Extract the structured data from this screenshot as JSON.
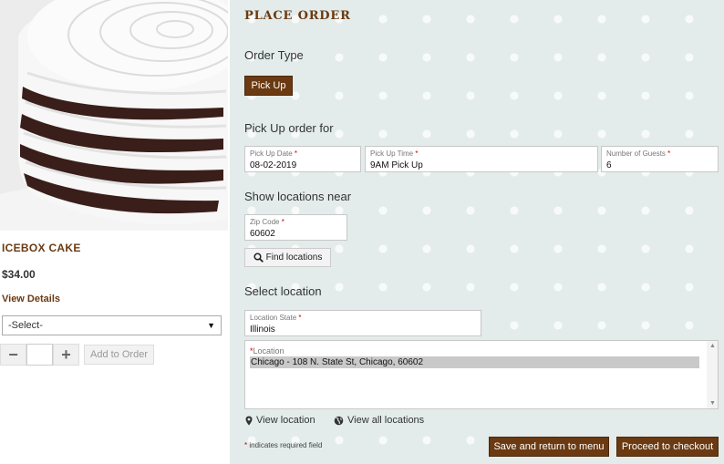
{
  "product": {
    "name": "ICEBOX CAKE",
    "price": "$34.00",
    "view_details": "View Details",
    "select_value": "-Select-",
    "minus": "−",
    "plus": "+",
    "add_to_order": "Add to Order"
  },
  "panel": {
    "title": "PLACE ORDER",
    "order_type_heading": "Order Type",
    "pickup_button": "Pick Up",
    "pickup_for_heading": "Pick Up order for",
    "pickup_date_label": "Pick Up Date",
    "pickup_date_value": "08-02-2019",
    "pickup_time_label": "Pick Up Time",
    "pickup_time_value": "9AM Pick Up",
    "guests_label": "Number of Guests",
    "guests_value": "6",
    "locations_near_heading": "Show locations near",
    "zip_label": "Zip Code",
    "zip_value": "60602",
    "find_locations": "Find locations",
    "select_location_heading": "Select location",
    "state_label": "Location State",
    "state_value": "Illinois",
    "location_label": "Location",
    "location_option": "Chicago - 108 N. State St, Chicago, 60602",
    "view_location": "View location",
    "view_all_locations": "View all locations",
    "required_note": "indicates required field",
    "required_mark": "*",
    "save_return": "Save and return to menu",
    "proceed_checkout": "Proceed to checkout"
  },
  "colors": {
    "brand_brown": "#6b3a12",
    "panel_bg": "#e3ecea",
    "required_red": "#cc0000"
  }
}
